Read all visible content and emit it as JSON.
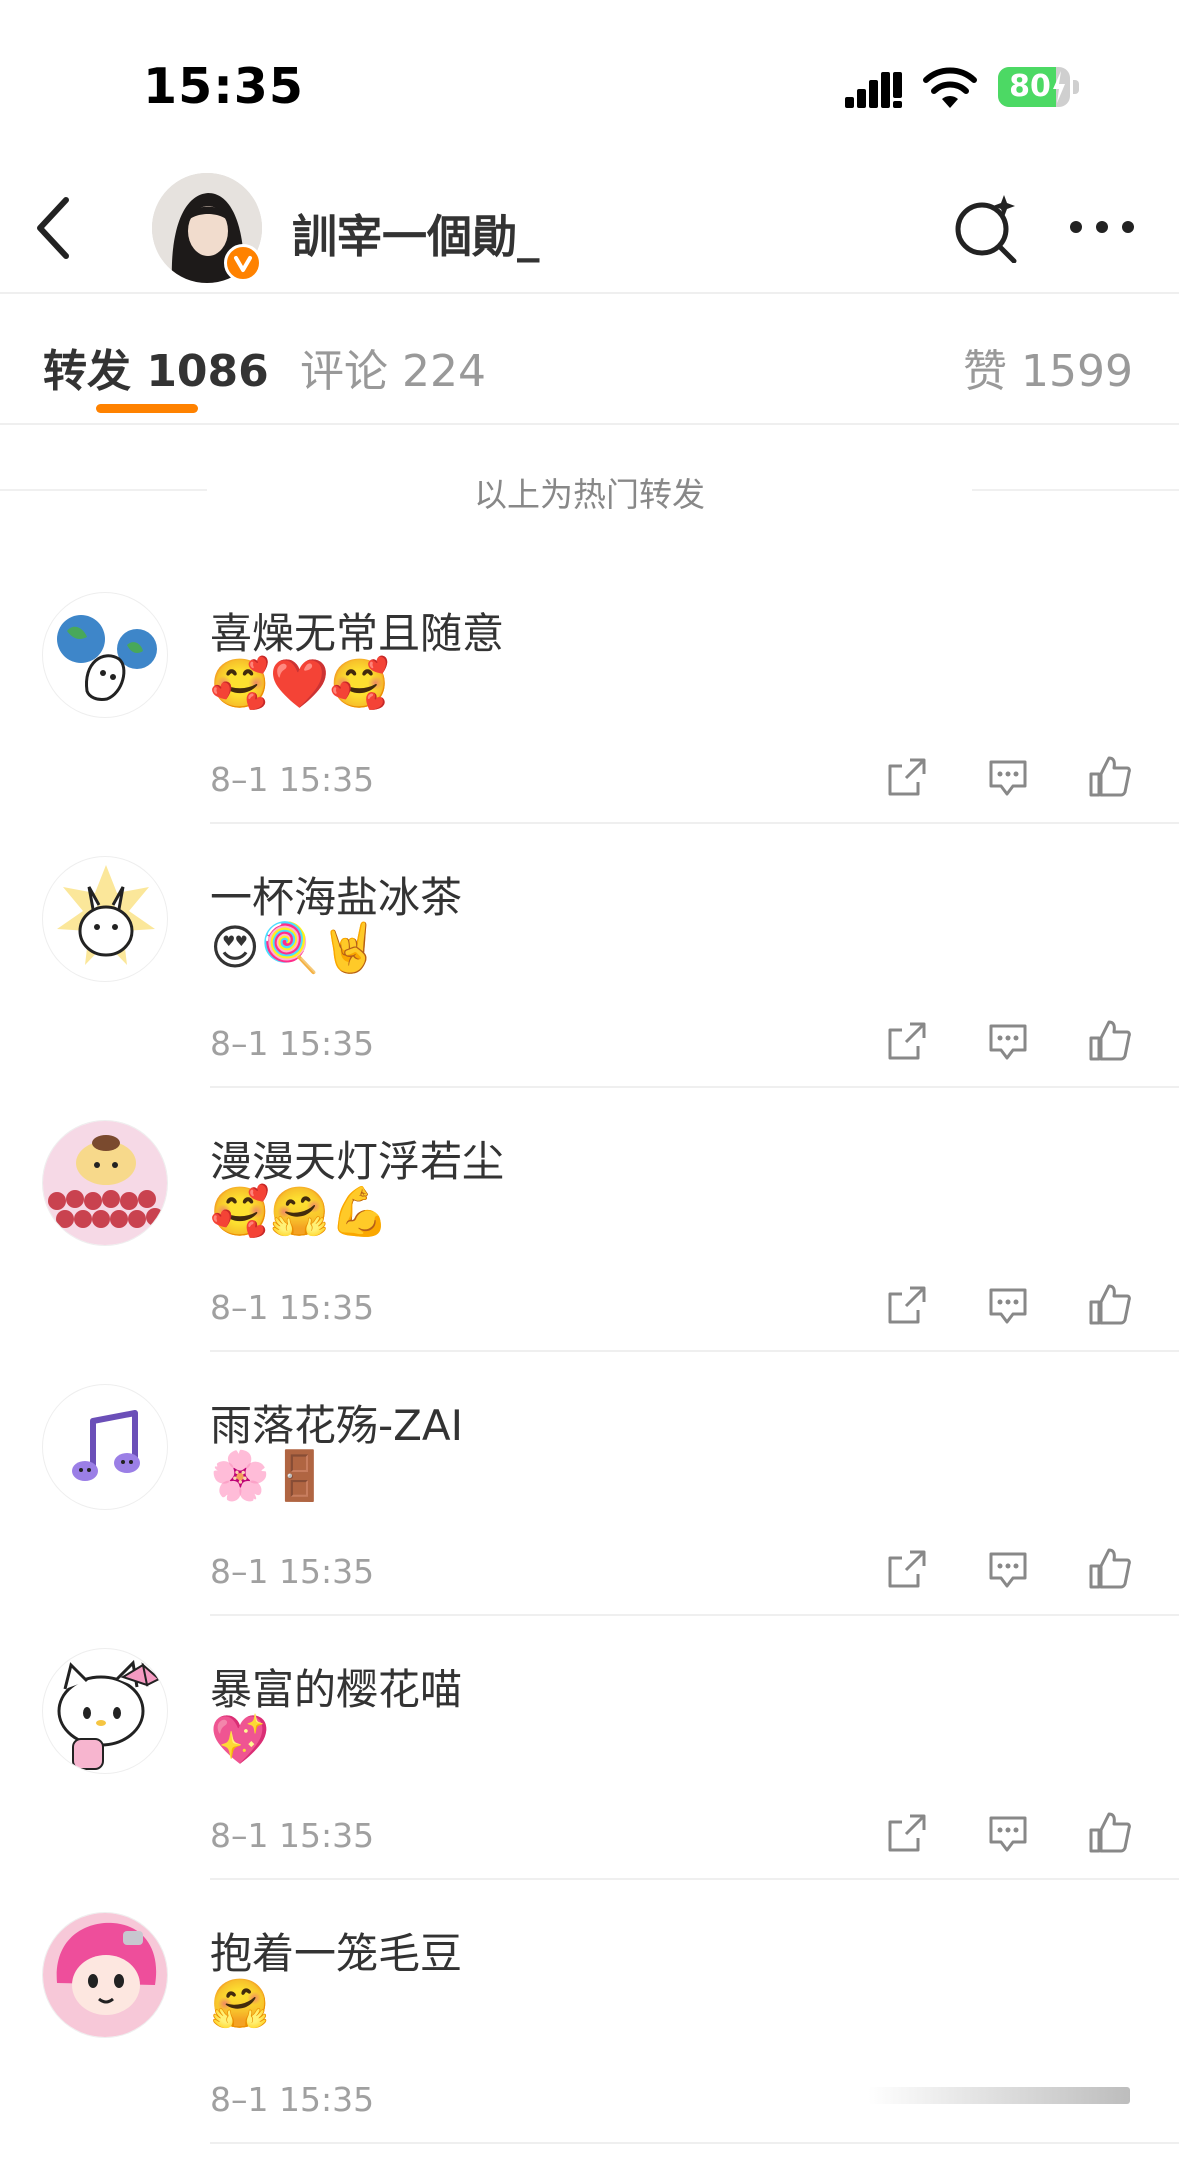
{
  "status_bar": {
    "time": "15:35",
    "battery": "80",
    "battery_level": 0.8
  },
  "header": {
    "username": "訓宰一個勛_"
  },
  "tabs": {
    "repost": "转发 1086",
    "comment": "评论 224",
    "like": "赞 1599"
  },
  "section_title": "以上为热门转发",
  "reposts": [
    {
      "name": "喜燥无常且随意",
      "emojis": "🥰❤️🥰",
      "time": "8–1 15:35",
      "avatar_icon": "earth-cat-avatar"
    },
    {
      "name": "一杯海盐冰茶",
      "emojis": "😍🍭🤘",
      "time": "8–1 15:35",
      "avatar_icon": "white-bunny-avatar"
    },
    {
      "name": "漫漫天灯浮若尘",
      "emojis": "🥰🤗💪",
      "time": "8–1 15:35",
      "avatar_icon": "pompompurin-roses-avatar"
    },
    {
      "name": "雨落花殇-ZAI",
      "emojis": "🌸🚪",
      "time": "8–1 15:35",
      "avatar_icon": "music-note-avatar"
    },
    {
      "name": "暴富的樱花喵",
      "emojis": "💖",
      "time": "8–1 15:35",
      "avatar_icon": "hello-kitty-avatar"
    },
    {
      "name": "抱着一笼毛豆",
      "emojis": "🤗",
      "time": "8–1 15:35",
      "avatar_icon": "pink-girl-avatar"
    }
  ],
  "colors": {
    "accent": "#ff8200",
    "text": "#333333",
    "muted": "#999999",
    "battery_green": "#4cd964"
  }
}
